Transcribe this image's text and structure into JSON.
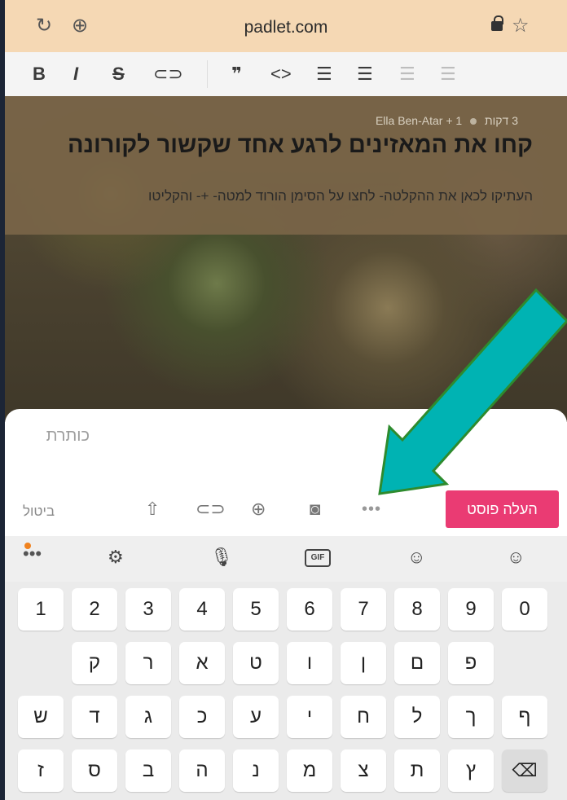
{
  "browser": {
    "url": "padlet.com"
  },
  "post": {
    "meta_time": "3 דקות",
    "meta_count": "1",
    "meta_author": "+ Ella Ben-Atar",
    "title": "קחו את המאזינים לרגע אחד שקשור לקורונה",
    "subtitle": "העתיקו לכאן את ההקלטה- לחצו על הסימן הורוד למטה- +- והקליטו"
  },
  "composer": {
    "title_placeholder": "כותרת",
    "cancel_label": "ביטול",
    "post_label": "העלה פוסט",
    "more_label": "•••"
  },
  "keyboard": {
    "gif_label": "GIF",
    "row_numbers": [
      "1",
      "2",
      "3",
      "4",
      "5",
      "6",
      "7",
      "8",
      "9",
      "0"
    ],
    "row1": [
      "ק",
      "ר",
      "א",
      "ט",
      "ו",
      "ן",
      "ם",
      "פ"
    ],
    "row2": [
      "ש",
      "ד",
      "ג",
      "כ",
      "ע",
      "י",
      "ח",
      "ל",
      "ך",
      "ף"
    ],
    "row3": [
      "ז",
      "ס",
      "ב",
      "ה",
      "נ",
      "מ",
      "צ",
      "ת",
      "ץ"
    ],
    "backspace": "⌫"
  },
  "colors": {
    "accent_pink": "#ea3b73",
    "arrow_teal": "#00b3b3",
    "urlbar": "#f5d8b4"
  }
}
